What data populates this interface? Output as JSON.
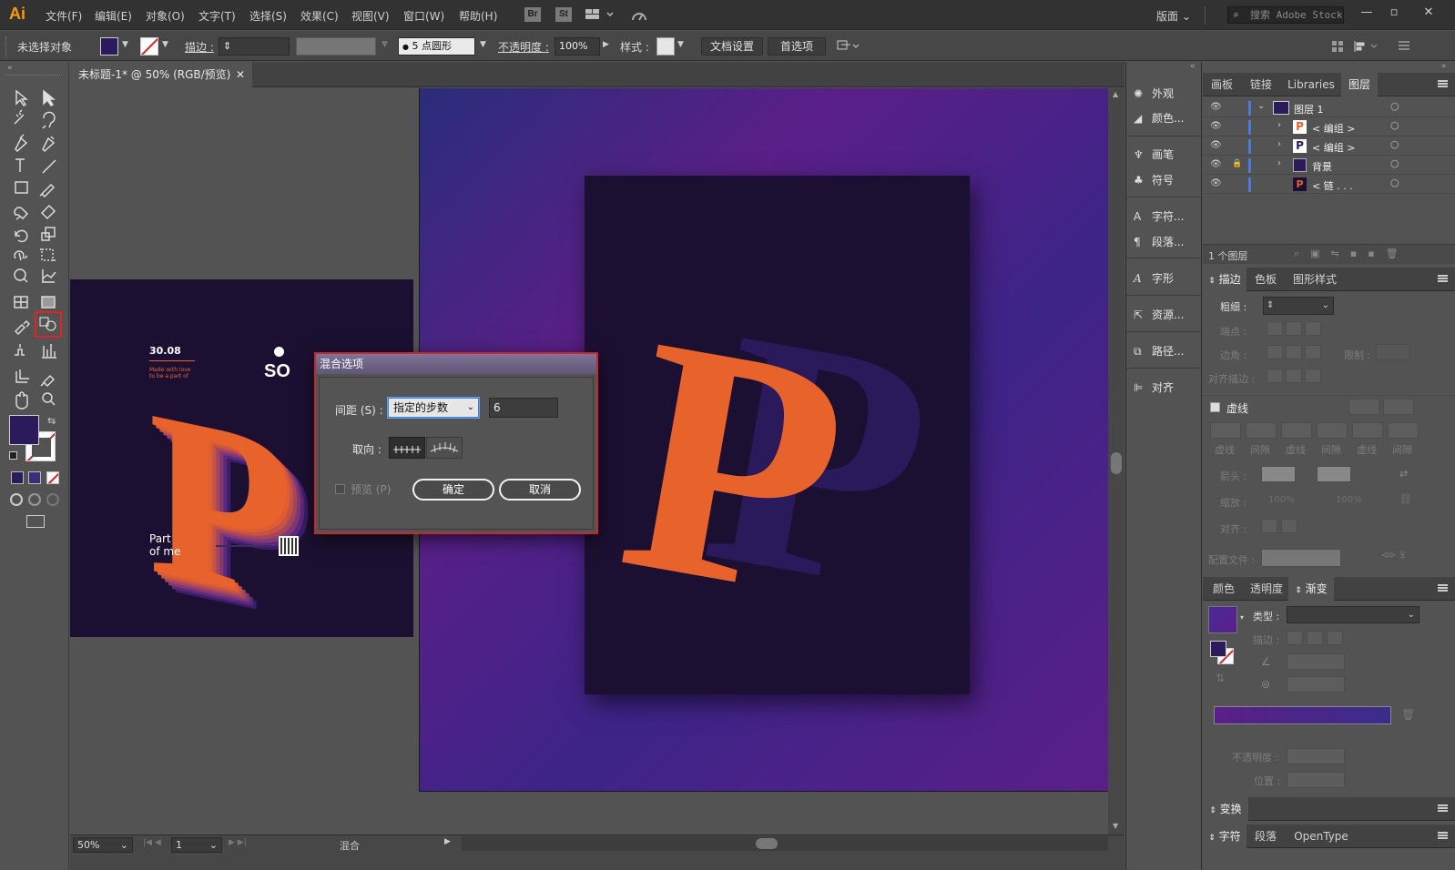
{
  "app": {
    "logo": "Ai"
  },
  "menu": [
    "文件(F)",
    "编辑(E)",
    "对象(O)",
    "文字(T)",
    "选择(S)",
    "效果(C)",
    "视图(V)",
    "窗口(W)",
    "帮助(H)"
  ],
  "bridge": {
    "br": "Br",
    "st": "St"
  },
  "workspace": "版面",
  "stock_search_placeholder": "搜索 Adobe Stock",
  "control": {
    "selection": "未选择对象",
    "stroke_label": "描边 :",
    "brush": "5 点圆形",
    "opacity_label": "不透明度 :",
    "opacity_value": "100%",
    "style_label": "样式 :",
    "doc_settings": "文档设置",
    "preferences": "首选项"
  },
  "document": {
    "tab_title": "未标题-1* @ 50% (RGB/预览)",
    "zoom": "50%",
    "page": "1",
    "status": "混合"
  },
  "poster": {
    "date": "30.08",
    "tagline": "Made with love\nto be a part of",
    "brand": "SO",
    "footer_title": "Part\nof me",
    "big_letter": "P"
  },
  "dialog": {
    "title": "混合选项",
    "spacing_label": "间距 (S) :",
    "spacing_mode": "指定的步数",
    "steps": "6",
    "orientation_label": "取向 :",
    "preview_label": "预览 (P)",
    "ok": "确定",
    "cancel": "取消"
  },
  "strip": [
    "外观",
    "颜色...",
    "画笔",
    "符号",
    "字符...",
    "段落...",
    "字形",
    "资源...",
    "路径...",
    "对齐"
  ],
  "layers_panel": {
    "tabs": [
      "画板",
      "链接",
      "Libraries",
      "图层"
    ],
    "active_tab": "图层",
    "layers": [
      {
        "name": "图层 1",
        "indent": 0
      },
      {
        "name": "< 编组 >",
        "indent": 1
      },
      {
        "name": "< 编组 >",
        "indent": 1
      },
      {
        "name": "背景",
        "indent": 1
      },
      {
        "name": "< 链 . . .",
        "indent": 1
      }
    ],
    "footer": "1 个图层"
  },
  "stroke_panel": {
    "tabs": [
      "描边",
      "色板",
      "图形样式"
    ],
    "weight_label": "粗细 :",
    "cap_label": "端点 :",
    "corner_label": "边角 :",
    "limit_label": "限制 :",
    "align_label": "对齐描边 :",
    "dashed_label": "虚线",
    "dash_labels": [
      "虚线",
      "间隙",
      "虚线",
      "间隙",
      "虚线",
      "间隙"
    ],
    "arrow_label": "箭头 :",
    "scale_label": "缩放 :",
    "scale_a": "100%",
    "scale_b": "100%",
    "align2_label": "对齐 :",
    "profile_label": "配置文件 :"
  },
  "gradient_panel": {
    "tabs": [
      "颜色",
      "透明度",
      "渐变"
    ],
    "type_label": "类型 :",
    "stroke_label": "描边 :",
    "opacity_label": "不透明度 :",
    "position_label": "位置 :"
  },
  "transform_panel": {
    "title": "变换"
  },
  "char_panel": {
    "tabs": [
      "字符",
      "段落",
      "OpenType"
    ]
  },
  "colors": {
    "accent_orange": "#e8632b",
    "deep_purple": "#1c1032",
    "fill_swatch": "#2b1a5c",
    "selection_red": "#c8282d"
  }
}
